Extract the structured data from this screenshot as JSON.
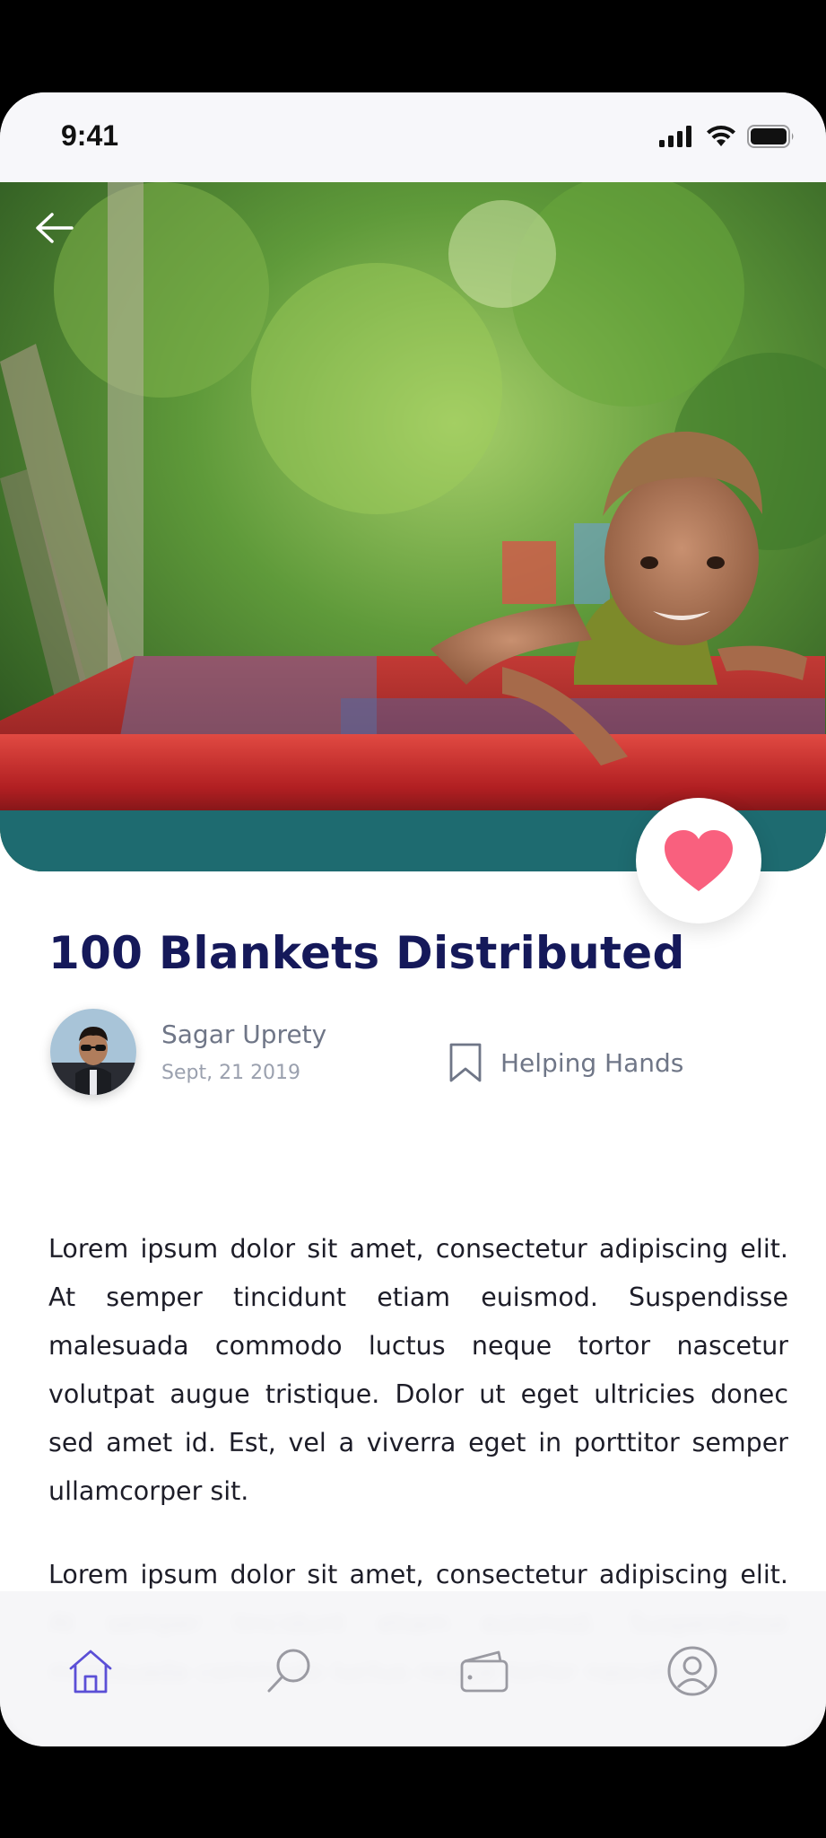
{
  "status_bar": {
    "time": "9:41"
  },
  "hero": {
    "image": "child-on-boat-photo"
  },
  "post": {
    "title": "100 Blankets Distributed",
    "author": {
      "name": "Sagar Uprety",
      "date": "Sept, 21 2019"
    },
    "tag": "Helping Hands",
    "paragraphs": [
      "Lorem ipsum dolor sit amet, consectetur adipiscing elit. At semper tincidunt etiam euismod. Suspendisse malesuada commodo luctus neque tortor nascetur volutpat augue tristique. Dolor ut eget ultricies donec sed amet id. Est, vel a viverra eget in porttitor semper ullamcorper sit.",
      "Lorem ipsum dolor sit amet, consectetur adipiscing elit. At semper tincidunt etiam euismod. Suspendisse malesuada commodo luctus neque tortor nascetur"
    ]
  },
  "tabs": [
    {
      "icon": "home-icon",
      "active": true
    },
    {
      "icon": "search-icon",
      "active": false
    },
    {
      "icon": "wallet-icon",
      "active": false
    },
    {
      "icon": "profile-icon",
      "active": false
    }
  ],
  "colors": {
    "title": "#15195a",
    "heart": "#f9607e",
    "active_tab": "#5b4fd6",
    "inactive_tab": "#9a9aa2"
  }
}
